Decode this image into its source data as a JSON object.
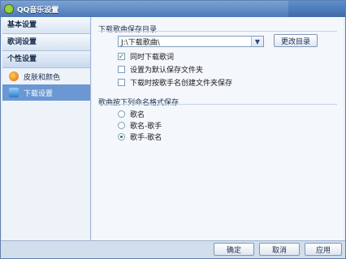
{
  "window": {
    "title": "QQ音乐设置"
  },
  "sidebar": {
    "sections": [
      {
        "label": "基本设置"
      },
      {
        "label": "歌词设置"
      },
      {
        "label": "个性设置"
      }
    ],
    "items": [
      {
        "label": "皮肤和颜色",
        "icon": "skin-icon"
      },
      {
        "label": "下载设置",
        "icon": "download-icon"
      }
    ]
  },
  "download_dir": {
    "group_title": "下载歌曲保存目录",
    "path_value": "J:\\下载歌曲\\",
    "change_button": "更改目录",
    "options": [
      {
        "label": "同时下载歌词",
        "checked": true
      },
      {
        "label": "设置为默认保存文件夹",
        "checked": false
      },
      {
        "label": "下载时按歌手名创建文件夹保存",
        "checked": false
      }
    ]
  },
  "naming": {
    "group_title": "歌曲按下列命名格式保存",
    "options": [
      {
        "label": "歌名",
        "selected": false
      },
      {
        "label": "歌名-歌手",
        "selected": false
      },
      {
        "label": "歌手-歌名",
        "selected": true
      }
    ]
  },
  "footer": {
    "ok": "确定",
    "cancel": "取消",
    "apply": "应用"
  }
}
